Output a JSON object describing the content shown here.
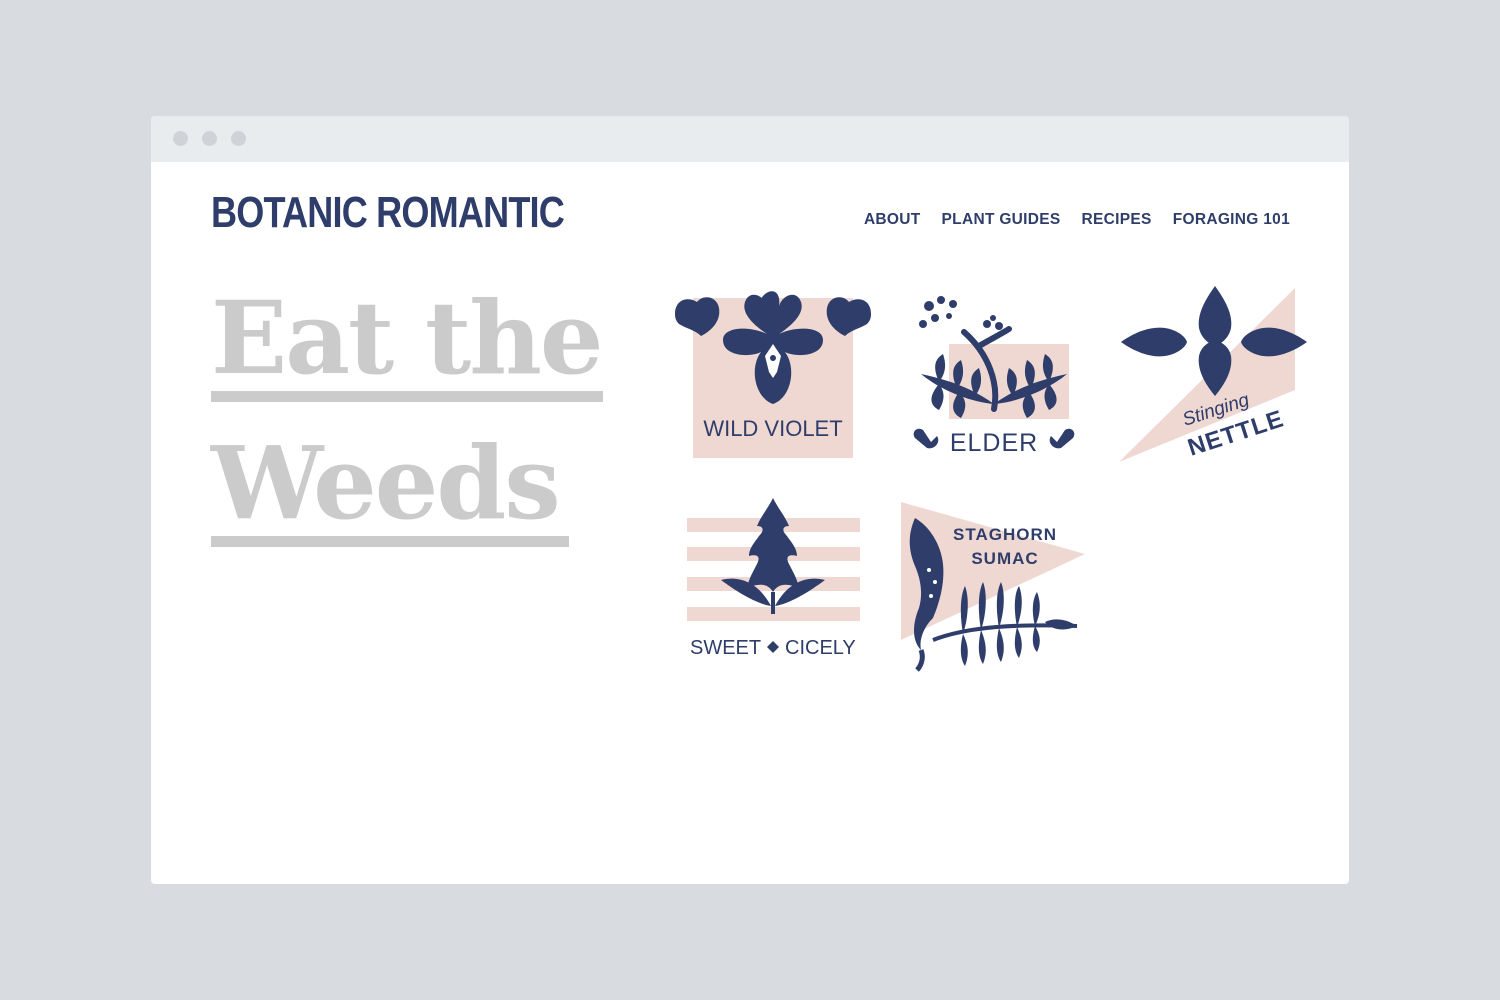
{
  "brand": {
    "name": "BOTANIC ROMANTIC",
    "navy": "#2f3d6b",
    "blush": "#efd8d2",
    "hero_gray": "#cbcbcb"
  },
  "nav": {
    "items": [
      {
        "label": "ABOUT"
      },
      {
        "label": "PLANT GUIDES"
      },
      {
        "label": "RECIPES"
      },
      {
        "label": "FORAGING 101"
      }
    ]
  },
  "hero": {
    "line1": "Eat the",
    "line2": "Weeds"
  },
  "badges": {
    "wild_violet": {
      "label": "WILD VIOLET"
    },
    "elder": {
      "label": "ELDER"
    },
    "stinging_nettle": {
      "line1": "Stinging",
      "line2": "NETTLE"
    },
    "sweet_cicely": {
      "word1": "SWEET",
      "word2": "CICELY"
    },
    "staghorn_sumac": {
      "line1": "STAGHORN",
      "line2": "SUMAC"
    }
  }
}
